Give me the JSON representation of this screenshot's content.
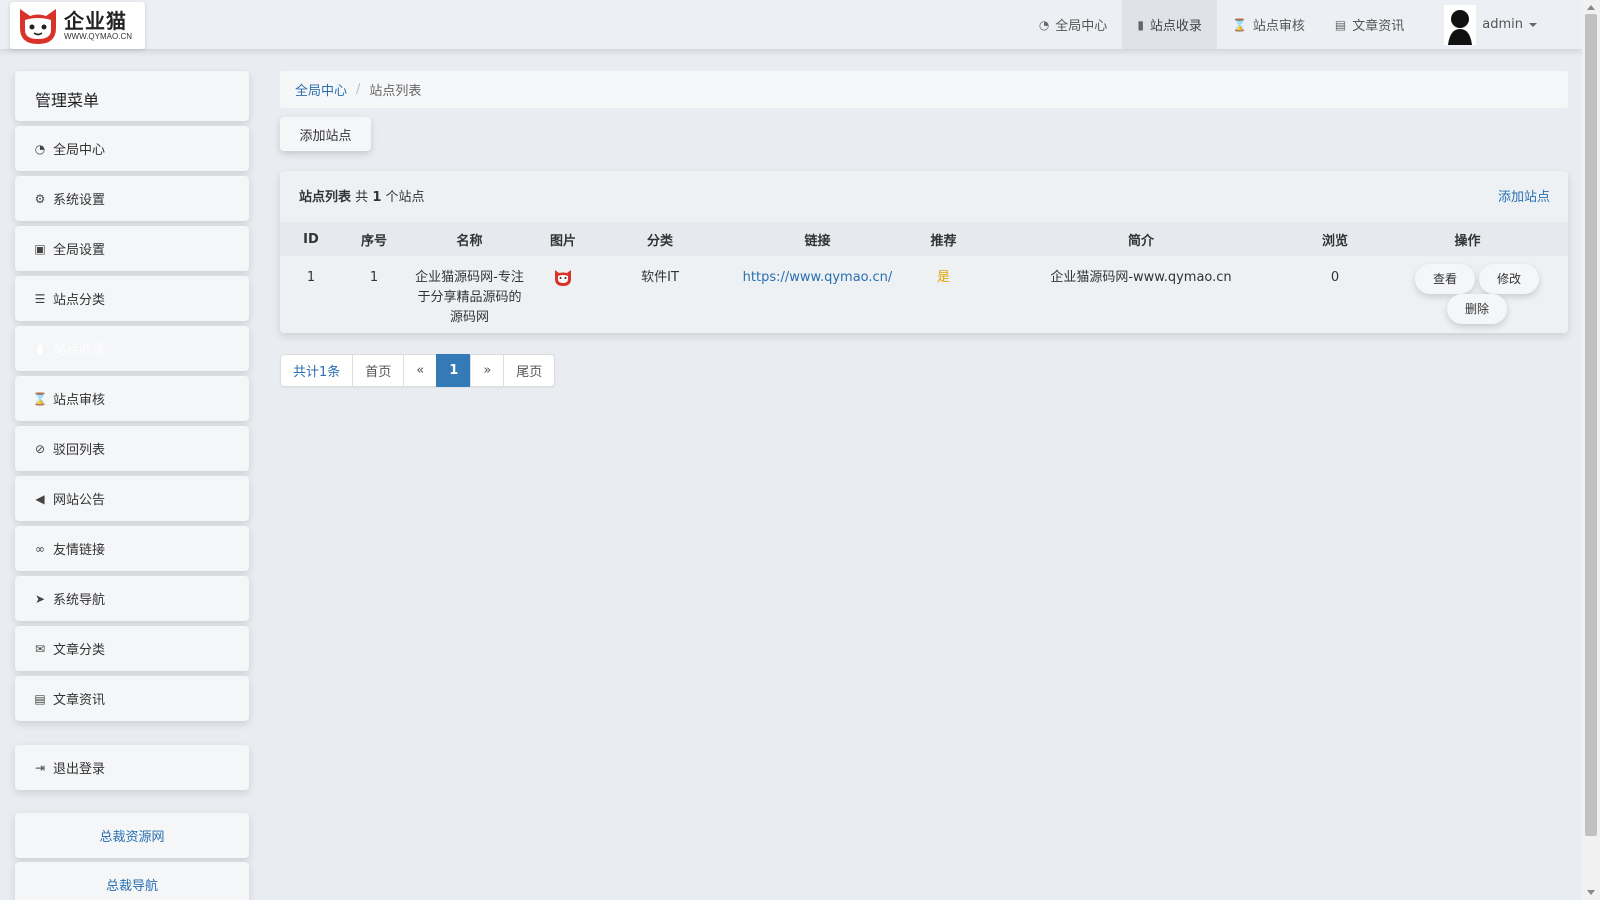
{
  "topbar": {
    "logo_text": "企业猫",
    "logo_url": "WWW.QYMAO.CN",
    "nav": [
      {
        "label": "全局中心",
        "icon": "dashboard-icon"
      },
      {
        "label": "站点收录",
        "icon": "book-icon"
      },
      {
        "label": "站点审核",
        "icon": "hourglass-icon"
      },
      {
        "label": "文章资讯",
        "icon": "newspaper-icon"
      }
    ],
    "user": "admin"
  },
  "sidebar": {
    "title": "管理菜单",
    "items": [
      {
        "label": "全局中心",
        "icon": "dashboard-icon"
      },
      {
        "label": "系统设置",
        "icon": "gear-icon"
      },
      {
        "label": "全局设置",
        "icon": "picture-icon"
      },
      {
        "label": "站点分类",
        "icon": "sliders-icon"
      },
      {
        "label": "站点收录",
        "icon": "book-icon"
      },
      {
        "label": "站点审核",
        "icon": "hourglass-icon"
      },
      {
        "label": "驳回列表",
        "icon": "ban-icon"
      },
      {
        "label": "网站公告",
        "icon": "bullhorn-icon"
      },
      {
        "label": "友情链接",
        "icon": "handshake-icon"
      },
      {
        "label": "系统导航",
        "icon": "location-arrow-icon"
      },
      {
        "label": "文章分类",
        "icon": "envelope-icon"
      },
      {
        "label": "文章资讯",
        "icon": "newspaper-icon"
      }
    ],
    "logout": "退出登录",
    "links": [
      "总裁资源网",
      "总裁导航"
    ]
  },
  "breadcrumb": {
    "home": "全局中心",
    "current": "站点列表"
  },
  "add_button": "添加站点",
  "panel": {
    "title": "站点列表",
    "count_prefix": "共",
    "count": "1",
    "count_suffix": "个站点",
    "add_link": "添加站点"
  },
  "table": {
    "headers": [
      "ID",
      "序号",
      "名称",
      "图片",
      "分类",
      "链接",
      "推荐",
      "简介",
      "浏览",
      "操作"
    ],
    "rows": [
      {
        "id": "1",
        "order": "1",
        "name": "企业猫源码网-专注于分享精品源码的源码网",
        "category": "软件IT",
        "link": "https://www.qymao.cn/",
        "recommend": "是",
        "intro": "企业猫源码网-www.qymao.cn",
        "views": "0",
        "ops": {
          "view": "查看",
          "edit": "修改",
          "delete": "删除"
        }
      }
    ]
  },
  "pager": {
    "total": "共计1条",
    "first": "首页",
    "prev": "«",
    "current": "1",
    "next": "»",
    "last": "尾页"
  },
  "colors": {
    "link": "#2a6fb0",
    "active_page": "#337ab7",
    "recommend": "#e6a400"
  }
}
